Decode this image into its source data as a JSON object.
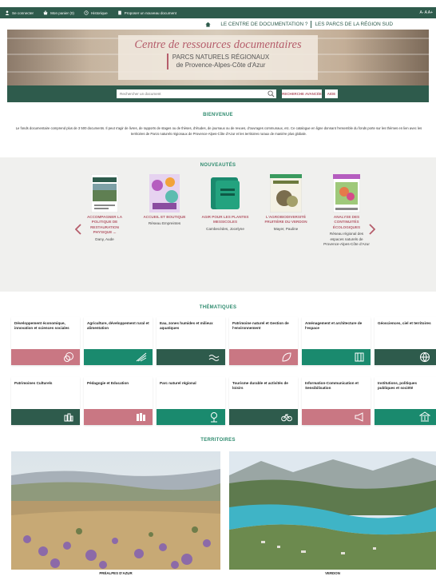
{
  "topbar": {
    "items": [
      {
        "label": "Se connecter",
        "icon": "user-icon"
      },
      {
        "label": "Mon panier (0)",
        "icon": "basket-icon"
      },
      {
        "label": "Historique",
        "icon": "history-icon"
      },
      {
        "label": "Proposer un nouveau document",
        "icon": "upload-icon"
      }
    ],
    "font_sizes": "A- A A+"
  },
  "nav": {
    "home_icon": "home-icon",
    "links": [
      "LE CENTRE DE DOCUMENTATION ?",
      "LES PARCS DE LA RÉGION SUD"
    ]
  },
  "banner": {
    "title": "Centre de ressources documentaires",
    "subtitle_1": "PARCS NATURELS RÉGIONAUX",
    "subtitle_2": "de Provence-Alpes-Côte d'Azur"
  },
  "search": {
    "placeholder": "Rechercher un document",
    "advanced_label": "RECHERCHE AVANCÉE",
    "help_label": "AIDE"
  },
  "welcome": {
    "title": "BIENVENUE",
    "text": "Le fonds documentaire comprend plus de 3 500 documents. Il peut s'agir de livres, de rapports de stages ou de thèses, d'études, de journaux ou de revues, d'ouvrages communaux, etc. Ce catalogue en ligne donnant l'ensemble du fonds porte sur les thèmes en lien avec les territoires de Parcs naturels régionaux de Provence-Alpes-Côte d'Azur et les territoires ruraux de manière plus globale."
  },
  "news": {
    "title": "NOUVEAUTÉS",
    "items": [
      {
        "title": "ACCOMPAGNER LA POLITIQUE DE RESTAURATION PHYSIQUE ...",
        "author": "Dany, Aude"
      },
      {
        "title": "ACCUEIL ET BOUTIQUE",
        "author": "Réseau Empreintes"
      },
      {
        "title": "AGIR POUR LES PLANTES MESSICOLES",
        "author": "Cambecèdes, Jocelyne"
      },
      {
        "title": "L'AGROBIODIVERSITÉ FRUITIÈRE DU VERDON",
        "author": "Mayer, Pauline"
      },
      {
        "title": "ANALYSE DES CONTINUITÉS ÉCOLOGIQUES",
        "author": "Réseau régional des espaces naturels de Provence-Alpes-Côte d'Azur"
      }
    ]
  },
  "themes": {
    "title": "THÉMATIQUES",
    "items": [
      {
        "label": "Développement économique, innovation et sciences sociales",
        "color": "#c97783",
        "icon": "coins-icon"
      },
      {
        "label": "Agriculture, développement rural et alimentation",
        "color": "#1a8a6e",
        "icon": "farm-icon"
      },
      {
        "label": "Eau, zones humides et milieux aquatiques",
        "color": "#2e5b4c",
        "icon": "water-icon"
      },
      {
        "label": "Patrimoine naturel et Gestion de l'environnement",
        "color": "#c97783",
        "icon": "leaf-icon"
      },
      {
        "label": "Aménagement et architecture de l'espace",
        "color": "#1a8a6e",
        "icon": "building-icon"
      },
      {
        "label": "Géosciences, ciel et territoires",
        "color": "#2e5b4c",
        "icon": "globe-icon"
      },
      {
        "label": "Patrimoines Culturels",
        "color": "#2e5b4c",
        "icon": "heritage-icon"
      },
      {
        "label": "Pédagogie et Education",
        "color": "#c97783",
        "icon": "books-icon"
      },
      {
        "label": "Parc naturel régional",
        "color": "#1a8a6e",
        "icon": "map-pin-icon"
      },
      {
        "label": "Tourisme durable et activités de loisirs",
        "color": "#2e5b4c",
        "icon": "bike-icon"
      },
      {
        "label": "Information-Communication et Sensibilisation",
        "color": "#c97783",
        "icon": "megaphone-icon"
      },
      {
        "label": "Institutions, politiques publiques et société",
        "color": "#1a8a6e",
        "icon": "institution-icon"
      }
    ]
  },
  "territories": {
    "title": "TERRITOIRES",
    "items": [
      {
        "label": "PRÉALPES D'AZUR"
      },
      {
        "label": "VERDON"
      }
    ]
  },
  "colors": {
    "dark_green": "#2e5b4c",
    "teal": "#1a8a6e",
    "rose": "#c97783",
    "accent_text": "#b55d6b"
  }
}
